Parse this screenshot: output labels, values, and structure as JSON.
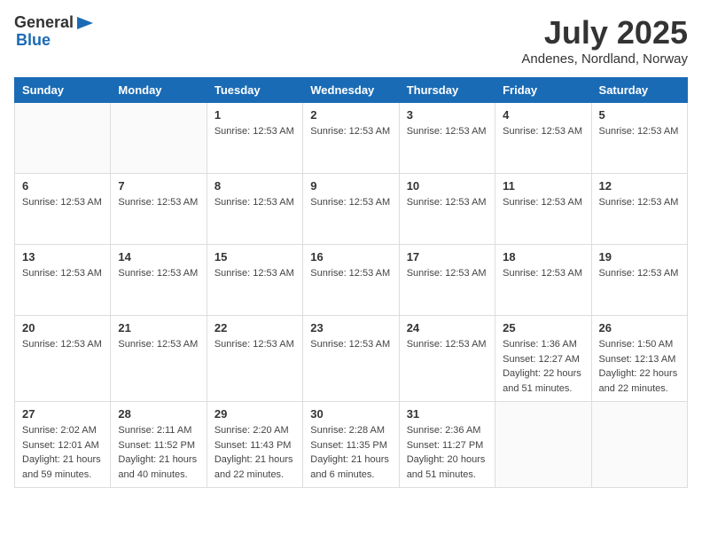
{
  "logo": {
    "text_general": "General",
    "text_blue": "Blue"
  },
  "header": {
    "month_year": "July 2025",
    "location": "Andenes, Nordland, Norway"
  },
  "weekdays": [
    "Sunday",
    "Monday",
    "Tuesday",
    "Wednesday",
    "Thursday",
    "Friday",
    "Saturday"
  ],
  "weeks": [
    [
      {
        "day": "",
        "info": ""
      },
      {
        "day": "",
        "info": ""
      },
      {
        "day": "1",
        "info": "Sunrise: 12:53 AM"
      },
      {
        "day": "2",
        "info": "Sunrise: 12:53 AM"
      },
      {
        "day": "3",
        "info": "Sunrise: 12:53 AM"
      },
      {
        "day": "4",
        "info": "Sunrise: 12:53 AM"
      },
      {
        "day": "5",
        "info": "Sunrise: 12:53 AM"
      }
    ],
    [
      {
        "day": "6",
        "info": "Sunrise: 12:53 AM"
      },
      {
        "day": "7",
        "info": "Sunrise: 12:53 AM"
      },
      {
        "day": "8",
        "info": "Sunrise: 12:53 AM"
      },
      {
        "day": "9",
        "info": "Sunrise: 12:53 AM"
      },
      {
        "day": "10",
        "info": "Sunrise: 12:53 AM"
      },
      {
        "day": "11",
        "info": "Sunrise: 12:53 AM"
      },
      {
        "day": "12",
        "info": "Sunrise: 12:53 AM"
      }
    ],
    [
      {
        "day": "13",
        "info": "Sunrise: 12:53 AM"
      },
      {
        "day": "14",
        "info": "Sunrise: 12:53 AM"
      },
      {
        "day": "15",
        "info": "Sunrise: 12:53 AM"
      },
      {
        "day": "16",
        "info": "Sunrise: 12:53 AM"
      },
      {
        "day": "17",
        "info": "Sunrise: 12:53 AM"
      },
      {
        "day": "18",
        "info": "Sunrise: 12:53 AM"
      },
      {
        "day": "19",
        "info": "Sunrise: 12:53 AM"
      }
    ],
    [
      {
        "day": "20",
        "info": "Sunrise: 12:53 AM"
      },
      {
        "day": "21",
        "info": "Sunrise: 12:53 AM"
      },
      {
        "day": "22",
        "info": "Sunrise: 12:53 AM"
      },
      {
        "day": "23",
        "info": "Sunrise: 12:53 AM"
      },
      {
        "day": "24",
        "info": "Sunrise: 12:53 AM"
      },
      {
        "day": "25",
        "info": "Sunrise: 1:36 AM\nSunset: 12:27 AM\nDaylight: 22 hours and 51 minutes."
      },
      {
        "day": "26",
        "info": "Sunrise: 1:50 AM\nSunset: 12:13 AM\nDaylight: 22 hours and 22 minutes."
      }
    ],
    [
      {
        "day": "27",
        "info": "Sunrise: 2:02 AM\nSunset: 12:01 AM\nDaylight: 21 hours and 59 minutes."
      },
      {
        "day": "28",
        "info": "Sunrise: 2:11 AM\nSunset: 11:52 PM\nDaylight: 21 hours and 40 minutes."
      },
      {
        "day": "29",
        "info": "Sunrise: 2:20 AM\nSunset: 11:43 PM\nDaylight: 21 hours and 22 minutes."
      },
      {
        "day": "30",
        "info": "Sunrise: 2:28 AM\nSunset: 11:35 PM\nDaylight: 21 hours and 6 minutes."
      },
      {
        "day": "31",
        "info": "Sunrise: 2:36 AM\nSunset: 11:27 PM\nDaylight: 20 hours and 51 minutes."
      },
      {
        "day": "",
        "info": ""
      },
      {
        "day": "",
        "info": ""
      }
    ]
  ]
}
